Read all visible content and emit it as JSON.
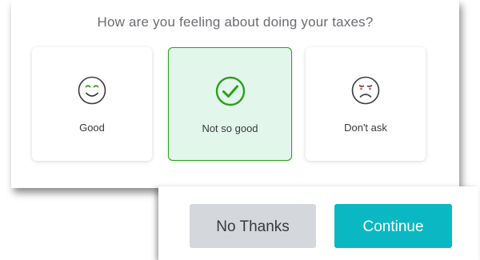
{
  "survey": {
    "question": "How are you feeling about doing your taxes?",
    "options": [
      {
        "label": "Good",
        "icon": "smiley-face-icon",
        "selected": false
      },
      {
        "label": "Not so good",
        "icon": "checkmark-circle-icon",
        "selected": true
      },
      {
        "label": "Don't ask",
        "icon": "sad-face-icon",
        "selected": false
      }
    ]
  },
  "actions": {
    "no_thanks_label": "No Thanks",
    "continue_label": "Continue"
  },
  "colors": {
    "selected_border": "#2ca01c",
    "selected_fill": "#e2f6ec",
    "continue_button": "#0ab8c4",
    "no_thanks_button": "#d4d7dc"
  }
}
